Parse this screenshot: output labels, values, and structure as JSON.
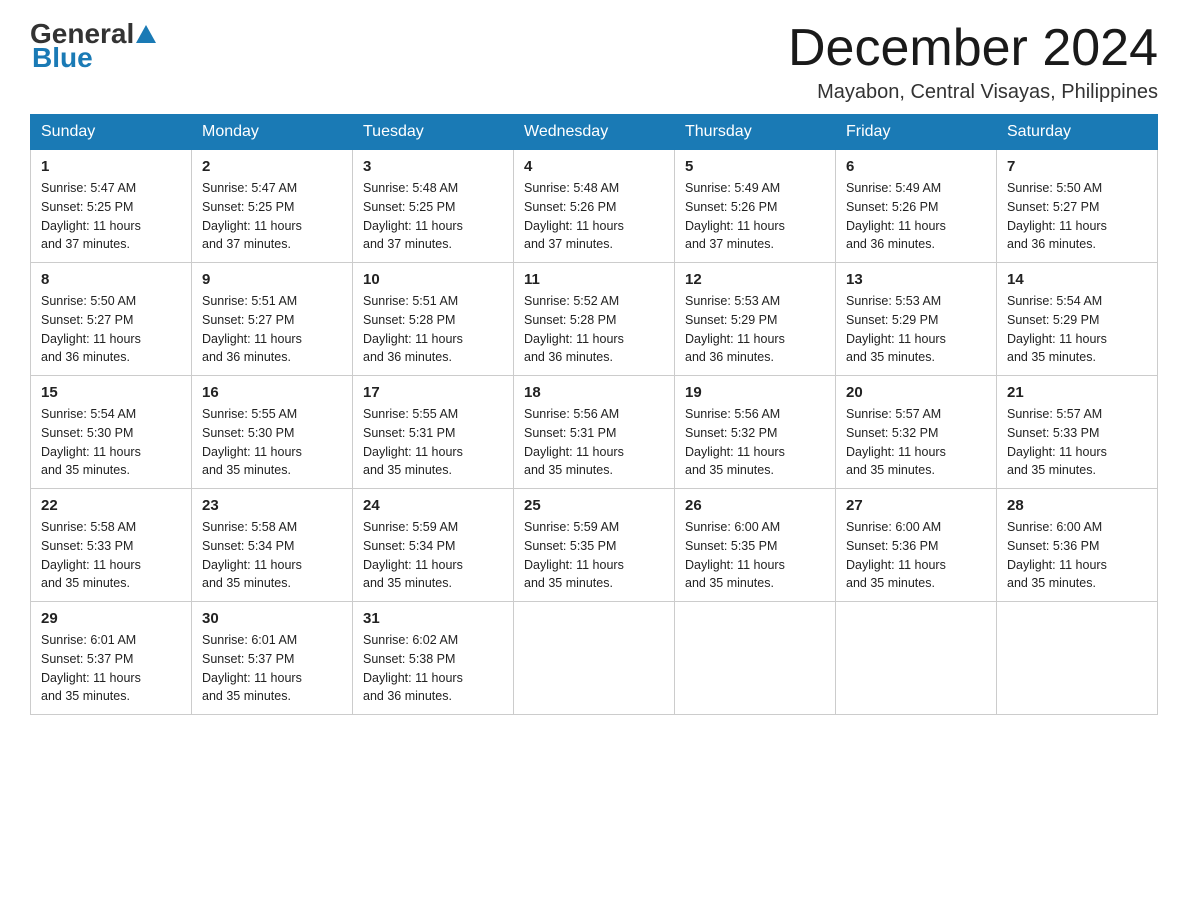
{
  "header": {
    "logo_general": "General",
    "logo_blue": "Blue",
    "month_title": "December 2024",
    "location": "Mayabon, Central Visayas, Philippines"
  },
  "days_of_week": [
    "Sunday",
    "Monday",
    "Tuesday",
    "Wednesday",
    "Thursday",
    "Friday",
    "Saturday"
  ],
  "weeks": [
    [
      {
        "day": "1",
        "sunrise": "5:47 AM",
        "sunset": "5:25 PM",
        "daylight": "11 hours and 37 minutes."
      },
      {
        "day": "2",
        "sunrise": "5:47 AM",
        "sunset": "5:25 PM",
        "daylight": "11 hours and 37 minutes."
      },
      {
        "day": "3",
        "sunrise": "5:48 AM",
        "sunset": "5:25 PM",
        "daylight": "11 hours and 37 minutes."
      },
      {
        "day": "4",
        "sunrise": "5:48 AM",
        "sunset": "5:26 PM",
        "daylight": "11 hours and 37 minutes."
      },
      {
        "day": "5",
        "sunrise": "5:49 AM",
        "sunset": "5:26 PM",
        "daylight": "11 hours and 37 minutes."
      },
      {
        "day": "6",
        "sunrise": "5:49 AM",
        "sunset": "5:26 PM",
        "daylight": "11 hours and 36 minutes."
      },
      {
        "day": "7",
        "sunrise": "5:50 AM",
        "sunset": "5:27 PM",
        "daylight": "11 hours and 36 minutes."
      }
    ],
    [
      {
        "day": "8",
        "sunrise": "5:50 AM",
        "sunset": "5:27 PM",
        "daylight": "11 hours and 36 minutes."
      },
      {
        "day": "9",
        "sunrise": "5:51 AM",
        "sunset": "5:27 PM",
        "daylight": "11 hours and 36 minutes."
      },
      {
        "day": "10",
        "sunrise": "5:51 AM",
        "sunset": "5:28 PM",
        "daylight": "11 hours and 36 minutes."
      },
      {
        "day": "11",
        "sunrise": "5:52 AM",
        "sunset": "5:28 PM",
        "daylight": "11 hours and 36 minutes."
      },
      {
        "day": "12",
        "sunrise": "5:53 AM",
        "sunset": "5:29 PM",
        "daylight": "11 hours and 36 minutes."
      },
      {
        "day": "13",
        "sunrise": "5:53 AM",
        "sunset": "5:29 PM",
        "daylight": "11 hours and 35 minutes."
      },
      {
        "day": "14",
        "sunrise": "5:54 AM",
        "sunset": "5:29 PM",
        "daylight": "11 hours and 35 minutes."
      }
    ],
    [
      {
        "day": "15",
        "sunrise": "5:54 AM",
        "sunset": "5:30 PM",
        "daylight": "11 hours and 35 minutes."
      },
      {
        "day": "16",
        "sunrise": "5:55 AM",
        "sunset": "5:30 PM",
        "daylight": "11 hours and 35 minutes."
      },
      {
        "day": "17",
        "sunrise": "5:55 AM",
        "sunset": "5:31 PM",
        "daylight": "11 hours and 35 minutes."
      },
      {
        "day": "18",
        "sunrise": "5:56 AM",
        "sunset": "5:31 PM",
        "daylight": "11 hours and 35 minutes."
      },
      {
        "day": "19",
        "sunrise": "5:56 AM",
        "sunset": "5:32 PM",
        "daylight": "11 hours and 35 minutes."
      },
      {
        "day": "20",
        "sunrise": "5:57 AM",
        "sunset": "5:32 PM",
        "daylight": "11 hours and 35 minutes."
      },
      {
        "day": "21",
        "sunrise": "5:57 AM",
        "sunset": "5:33 PM",
        "daylight": "11 hours and 35 minutes."
      }
    ],
    [
      {
        "day": "22",
        "sunrise": "5:58 AM",
        "sunset": "5:33 PM",
        "daylight": "11 hours and 35 minutes."
      },
      {
        "day": "23",
        "sunrise": "5:58 AM",
        "sunset": "5:34 PM",
        "daylight": "11 hours and 35 minutes."
      },
      {
        "day": "24",
        "sunrise": "5:59 AM",
        "sunset": "5:34 PM",
        "daylight": "11 hours and 35 minutes."
      },
      {
        "day": "25",
        "sunrise": "5:59 AM",
        "sunset": "5:35 PM",
        "daylight": "11 hours and 35 minutes."
      },
      {
        "day": "26",
        "sunrise": "6:00 AM",
        "sunset": "5:35 PM",
        "daylight": "11 hours and 35 minutes."
      },
      {
        "day": "27",
        "sunrise": "6:00 AM",
        "sunset": "5:36 PM",
        "daylight": "11 hours and 35 minutes."
      },
      {
        "day": "28",
        "sunrise": "6:00 AM",
        "sunset": "5:36 PM",
        "daylight": "11 hours and 35 minutes."
      }
    ],
    [
      {
        "day": "29",
        "sunrise": "6:01 AM",
        "sunset": "5:37 PM",
        "daylight": "11 hours and 35 minutes."
      },
      {
        "day": "30",
        "sunrise": "6:01 AM",
        "sunset": "5:37 PM",
        "daylight": "11 hours and 35 minutes."
      },
      {
        "day": "31",
        "sunrise": "6:02 AM",
        "sunset": "5:38 PM",
        "daylight": "11 hours and 36 minutes."
      },
      null,
      null,
      null,
      null
    ]
  ],
  "labels": {
    "sunrise_prefix": "Sunrise: ",
    "sunset_prefix": "Sunset: ",
    "daylight_prefix": "Daylight: "
  }
}
